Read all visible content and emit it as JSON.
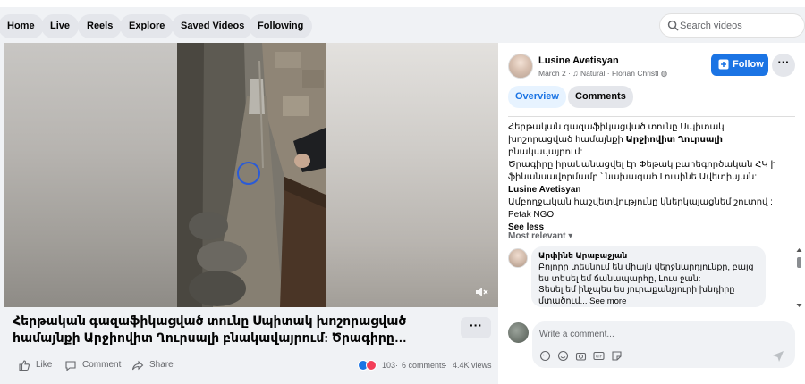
{
  "nav": {
    "tabs": [
      {
        "label": "Home"
      },
      {
        "label": "Live"
      },
      {
        "label": "Reels"
      },
      {
        "label": "Explore"
      },
      {
        "label": "Saved Videos"
      },
      {
        "label": "Following"
      }
    ],
    "search_placeholder": "Search videos"
  },
  "video": {
    "title": "Հերթական գազաֆիկացված տունը Սպիտակ խոշորացված համայնքի Արջիովիտ Ղուրսալի բնակավայրում: Ծրագիրը…",
    "muted_icon": "volume-muted-icon"
  },
  "actions": {
    "like": "Like",
    "comment": "Comment",
    "share": "Share"
  },
  "stats": {
    "reactions": "103",
    "comments": "6 comments",
    "views": "4.4K views",
    "separator": "·"
  },
  "panel": {
    "author": "Lusine Avetisyan",
    "date": "March 2",
    "music": "♫ Natural · Florian Christl",
    "follow_label": "Follow",
    "more_label": "···",
    "tabs": {
      "overview": "Overview",
      "comments": "Comments"
    },
    "description": {
      "p1": "Հերթական գազաֆիկացված տունը Սպիտակ խոշորացված համայնքի",
      "p1_bold": "Արջիովիտ Ղուրսալի",
      "p1_end": "բնակավայրում:",
      "p2": "Ծրագիրը իրականացվել էր Փեթակ բարեգործական ՀԿ ի ֆինանսավորմամբ ՝ նախագահ Լուսինե Ավետիսյան:",
      "p2_bold": "Lusine Avetisyan",
      "p3": "Ամբողջական հաշվետվությունը կներկայացնեմ շուտով :",
      "p4": "Petak NGO",
      "see_less": "See less"
    },
    "sort_label": "Most relevant",
    "comment": {
      "author": "Արփինե Արաբաջյան",
      "text_lines": [
        "Բոլորը տեսնում են միայն վերջնարդյունքը, բայց",
        "ես տեսել եմ ճանապարհը, Լուս ջան:",
        "Տեսել եմ ինչպես ես յուրաքանչյուրի խնդիրը",
        "մտածում... See more"
      ]
    },
    "composer_placeholder": "Write a comment..."
  },
  "colors": {
    "accent": "#1b74e4",
    "page_bg": "#f0f2f5",
    "pill_bg": "#e4e6eb"
  }
}
